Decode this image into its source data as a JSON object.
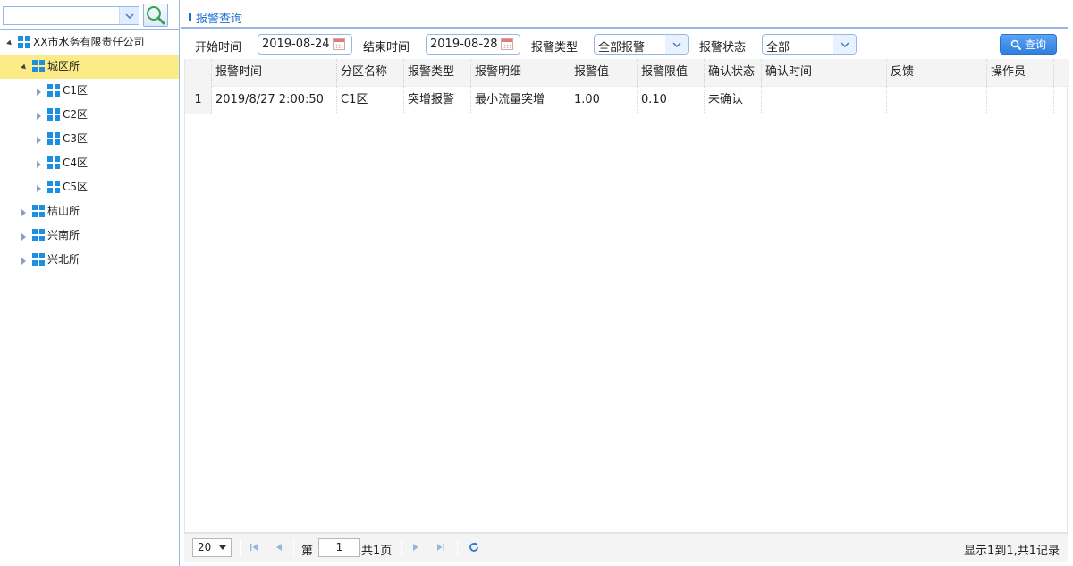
{
  "tree": {
    "search": {
      "value": ""
    },
    "nodes": [
      {
        "label": "XX市水务有限责任公司",
        "level": 0,
        "state": "expanded",
        "selected": false
      },
      {
        "label": "城区所",
        "level": 1,
        "state": "expanded",
        "selected": true
      },
      {
        "label": "C1区",
        "level": 2,
        "state": "collapsed",
        "selected": false
      },
      {
        "label": "C2区",
        "level": 2,
        "state": "collapsed",
        "selected": false
      },
      {
        "label": "C3区",
        "level": 2,
        "state": "collapsed",
        "selected": false
      },
      {
        "label": "C4区",
        "level": 2,
        "state": "collapsed",
        "selected": false
      },
      {
        "label": "C5区",
        "level": 2,
        "state": "collapsed",
        "selected": false
      },
      {
        "label": "桔山所",
        "level": 1,
        "state": "collapsed",
        "selected": false
      },
      {
        "label": "兴南所",
        "level": 1,
        "state": "collapsed",
        "selected": false
      },
      {
        "label": "兴北所",
        "level": 1,
        "state": "collapsed",
        "selected": false
      }
    ]
  },
  "panel": {
    "title": "报警查询"
  },
  "filters": {
    "start_label": "开始时间",
    "start_value": "2019-08-24",
    "end_label": "结束时间",
    "end_value": "2019-08-28",
    "type_label": "报警类型",
    "type_value": "全部报警",
    "status_label": "报警状态",
    "status_value": "全部",
    "query_label": "查询"
  },
  "grid": {
    "columns": [
      "报警时间",
      "分区名称",
      "报警类型",
      "报警明细",
      "报警值",
      "报警限值",
      "确认状态",
      "确认时间",
      "反馈",
      "操作员"
    ],
    "rows": [
      [
        "1",
        "2019/8/27 2:00:50",
        "C1区",
        "突增报警",
        "最小流量突增",
        "1.00",
        "0.10",
        "未确认",
        "",
        "",
        ""
      ]
    ]
  },
  "pager": {
    "page_size": "20",
    "page_prefix": "第",
    "page_value": "1",
    "page_total": "共1页",
    "info": "显示1到1,共1记录"
  },
  "colors": {
    "accent": "#1e6fd0",
    "border": "#95b8e7",
    "selected": "#fbec88",
    "tree_icon": "#1d8ee0"
  }
}
